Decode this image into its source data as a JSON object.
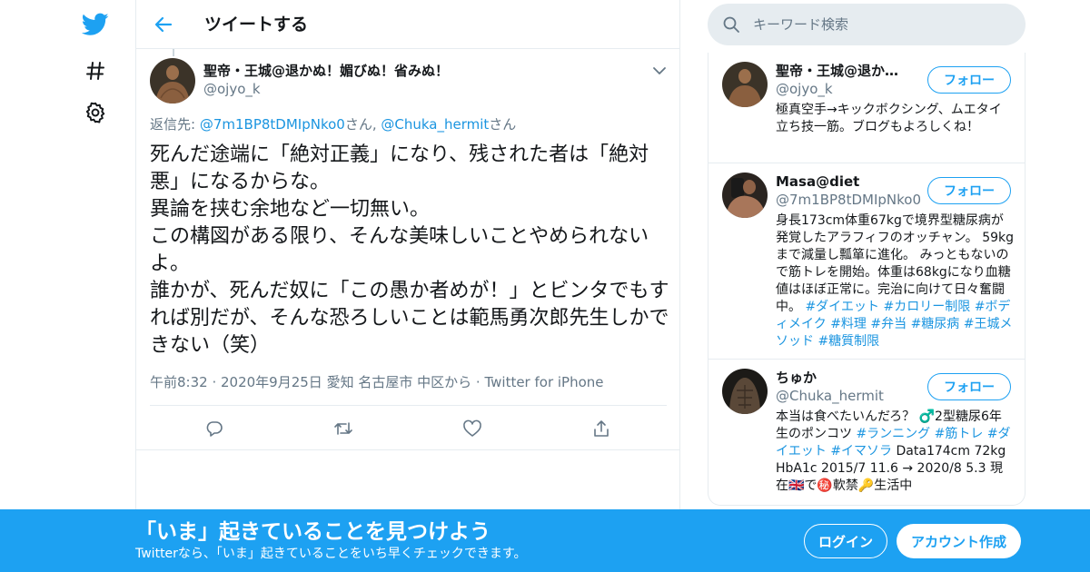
{
  "colors": {
    "accent": "#1da1f2",
    "link": "#1b95e0",
    "muted": "#657786",
    "border": "#e6ecf0"
  },
  "nav": {
    "icons": [
      "twitter-logo-icon",
      "hashtag-icon",
      "gear-icon"
    ]
  },
  "header": {
    "title": "ツイートする"
  },
  "tweet": {
    "author_name": "聖帝・王城@退かぬ！媚びぬ！省みぬ！",
    "author_handle": "@ojyo_k",
    "reply_prefix": "返信先: ",
    "reply_user1": "@7m1BP8tDMIpNko0",
    "reply_suffix1": "さん, ",
    "reply_user2": "@Chuka_hermit",
    "reply_suffix2": "さん",
    "text": "死んだ途端に「絶対正義」になり、残された者は「絶対悪」になるからな。\n異論を挟む余地など一切無い。\nこの構図がある限り、そんな美味しいことやめられないよ。\n誰かが、死んだ奴に「この愚か者めが！」とビンタでもすれば別だが、そんな恐ろしいことは範馬勇次郎先生しかできない（笑）",
    "time": "午前8:32",
    "date": "2020年9月25日",
    "location": "愛知 名古屋市 中区から",
    "source": "Twitter for iPhone"
  },
  "search": {
    "placeholder": "キーワード検索"
  },
  "users": [
    {
      "name": "聖帝・王城@退かぬ！媚びぬ！省みぬ！",
      "handle": "@ojyo_k",
      "follow_label": "フォロー",
      "bio": "極真空手→キックボクシング、ムエタイ 立ち技一筋。ブログもよろしくね！"
    },
    {
      "name": "Masa@diet",
      "handle": "@7m1BP8tDMIpNko0",
      "follow_label": "フォロー",
      "bio_plain": "身長173cm体重67kgで境界型糖尿病が発覚したアラフィフのオッチャン。 59kgまで減量し瓢箪に進化。 みっともないので筋トレを開始。体重は68kgになり血糖値はほぼ正常に。完治に向けて日々奮闘中。 ",
      "tags": [
        "#ダイエット",
        "#カロリー制限",
        "#ボディメイク",
        "#料理",
        "#弁当",
        "#糖尿病",
        "#王城メソッド",
        "#糖質制限"
      ]
    },
    {
      "name": "ちゅか",
      "handle": "@Chuka_hermit",
      "follow_label": "フォロー",
      "bio_a": "本当は食べたいんだろ？ ♂️2型糖尿6年生のポンコツ ",
      "tag_a": "#ランニング",
      "tag_b": "#筋トレ",
      "tag_c": "#ダイエット",
      "tag_d": "#イマソラ",
      "bio_b": " Data174cm 72kg HbA1c 2015/7 11.6 → 2020/8 5.3 現在🇬🇧で㊙️軟禁🔑生活中"
    }
  ],
  "banner": {
    "title": "「いま」起きていることを見つけよう",
    "subtitle": "Twitterなら、「いま」起きていることをいち早くチェックできます。",
    "login_label": "ログイン",
    "signup_label": "アカウント作成"
  }
}
